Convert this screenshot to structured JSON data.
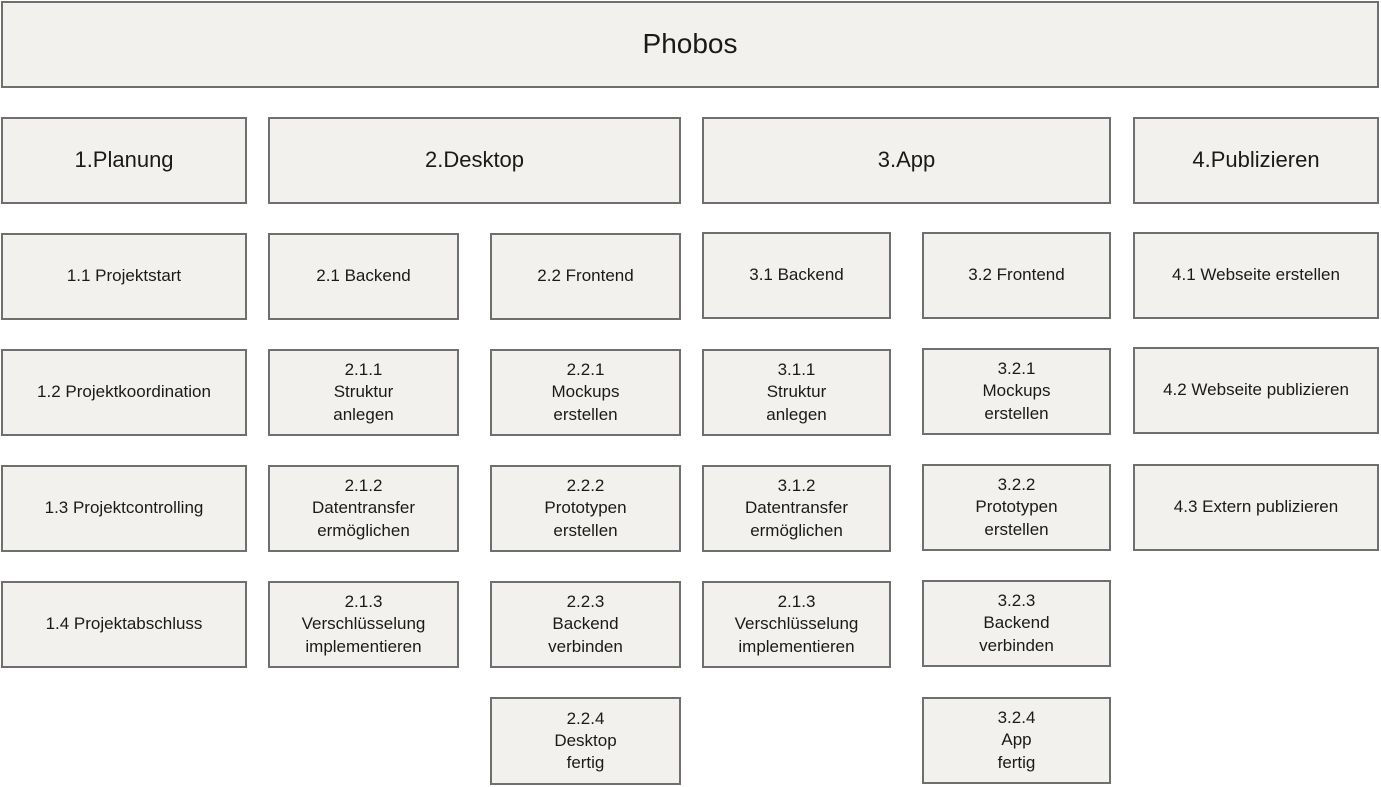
{
  "root": {
    "label": "Phobos"
  },
  "phases": [
    {
      "label": "1.Planung",
      "items": [
        {
          "label": "1.1 Projektstart"
        },
        {
          "label": "1.2 Projektkoordination"
        },
        {
          "label": "1.3 Projektcontrolling"
        },
        {
          "label": "1.4 Projektabschluss"
        }
      ]
    },
    {
      "label": "2.Desktop",
      "groups": [
        {
          "label": "2.1 Backend",
          "items": [
            {
              "label": "2.1.1\nStruktur\nanlegen"
            },
            {
              "label": "2.1.2\nDatentransfer\nermöglichen"
            },
            {
              "label": "2.1.3\nVerschlüsselung\nimplementieren"
            }
          ]
        },
        {
          "label": "2.2 Frontend",
          "items": [
            {
              "label": "2.2.1\nMockups\nerstellen"
            },
            {
              "label": "2.2.2\nPrototypen\nerstellen"
            },
            {
              "label": "2.2.3\nBackend\nverbinden"
            },
            {
              "label": "2.2.4\nDesktop\nfertig"
            }
          ]
        }
      ]
    },
    {
      "label": "3.App",
      "groups": [
        {
          "label": "3.1 Backend",
          "items": [
            {
              "label": "3.1.1\nStruktur\nanlegen"
            },
            {
              "label": "3.1.2\nDatentransfer\nermöglichen"
            },
            {
              "label": "2.1.3\nVerschlüsselung\nimplementieren"
            }
          ]
        },
        {
          "label": "3.2 Frontend",
          "items": [
            {
              "label": "3.2.1\nMockups\nerstellen"
            },
            {
              "label": "3.2.2\nPrototypen\nerstellen"
            },
            {
              "label": "3.2.3\nBackend\nverbinden"
            },
            {
              "label": "3.2.4\nApp\nfertig"
            }
          ]
        }
      ]
    },
    {
      "label": "4.Publizieren",
      "items": [
        {
          "label": "4.1 Webseite erstellen"
        },
        {
          "label": "4.2 Webseite publizieren"
        },
        {
          "label": "4.3 Extern publizieren"
        }
      ]
    }
  ]
}
